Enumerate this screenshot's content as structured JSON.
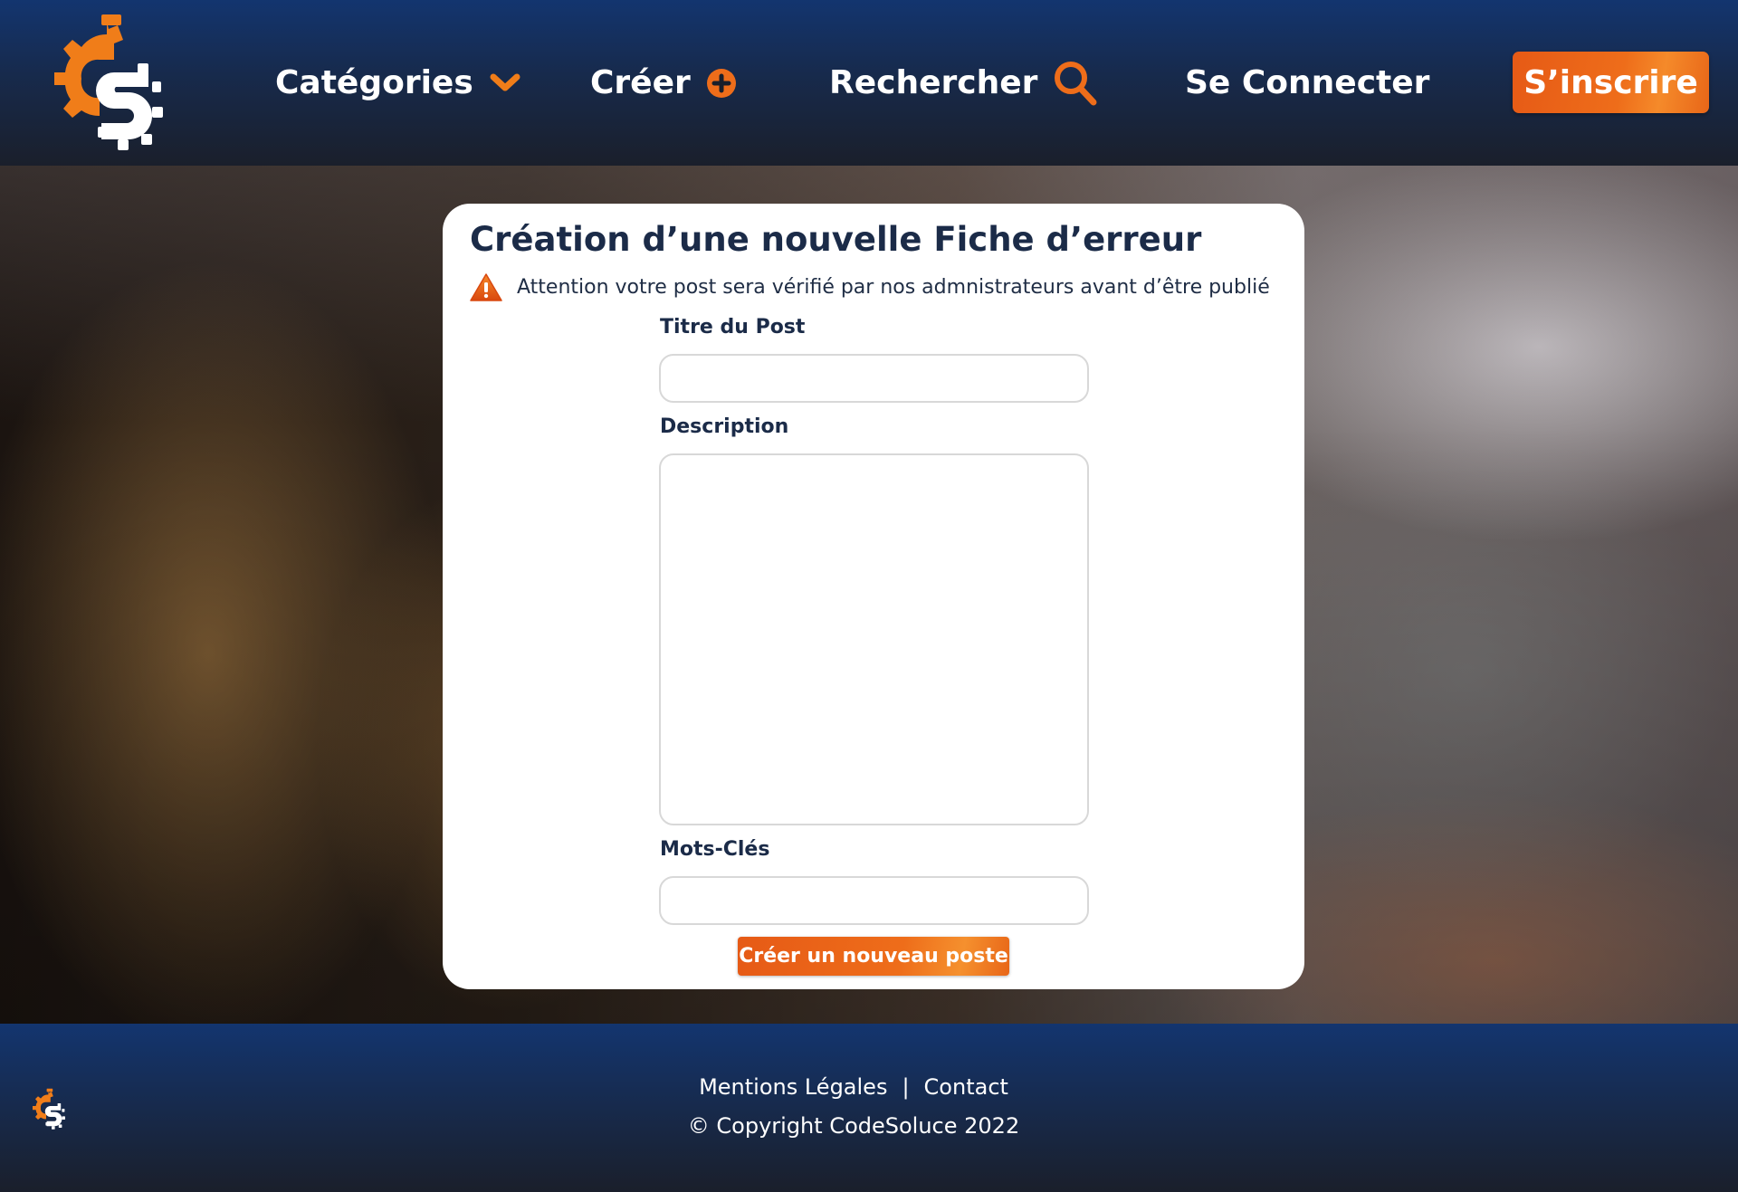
{
  "brand": {
    "logo_icon": "codesoluce-gear-logo",
    "colors": {
      "accent": "#ee6d1a",
      "navy": "#13356f",
      "dark": "#1a1f2b",
      "title": "#1b2b48"
    }
  },
  "nav": {
    "categories_label": "Catégories",
    "categories_icon": "chevron-down-icon",
    "create_label": "Créer",
    "create_icon": "plus-circle-icon",
    "search_label": "Rechercher",
    "search_icon": "search-icon",
    "login_label": "Se Connecter",
    "signup_label": "S’inscrire"
  },
  "form": {
    "title": "Création d’une nouvelle Fiche d’erreur",
    "warning_icon": "warning-icon",
    "warning_text": "Attention votre post sera vérifié par nos admnistrateurs avant d’être publié",
    "post_title_label": "Titre du Post",
    "post_title_value": "",
    "description_label": "Description",
    "description_value": "",
    "keywords_label": "Mots-Clés",
    "keywords_value": "",
    "submit_label": "Créer un nouveau poste"
  },
  "footer": {
    "legal_label": "Mentions Légales",
    "separator": "|",
    "contact_label": "Contact",
    "copyright": "© Copyright CodeSoluce 2022"
  }
}
